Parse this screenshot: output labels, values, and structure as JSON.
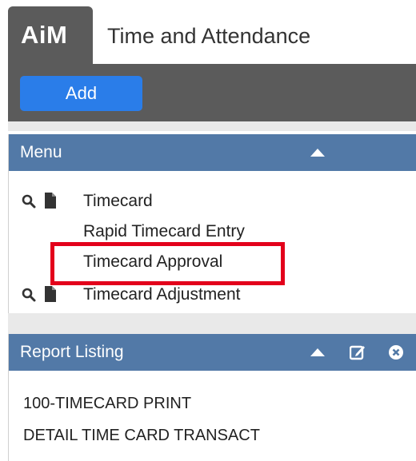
{
  "header": {
    "logo": "AiM",
    "title": "Time and Attendance"
  },
  "toolbar": {
    "add_label": "Add"
  },
  "menu_panel": {
    "title": "Menu",
    "items": [
      {
        "label": "Timecard",
        "has_search": true,
        "has_doc": true
      },
      {
        "label": "Rapid Timecard Entry",
        "has_search": false,
        "has_doc": false
      },
      {
        "label": "Timecard Approval",
        "has_search": false,
        "has_doc": false,
        "highlighted": true
      },
      {
        "label": "Timecard Adjustment",
        "has_search": true,
        "has_doc": true
      }
    ]
  },
  "report_panel": {
    "title": "Report Listing",
    "items": [
      "100-TIMECARD PRINT",
      "DETAIL TIME CARD TRANSACT"
    ]
  },
  "colors": {
    "header_gray": "#5b5b5b",
    "add_blue": "#2a7de9",
    "panel_blue": "#5279a7",
    "highlight_red": "#e3001b"
  }
}
